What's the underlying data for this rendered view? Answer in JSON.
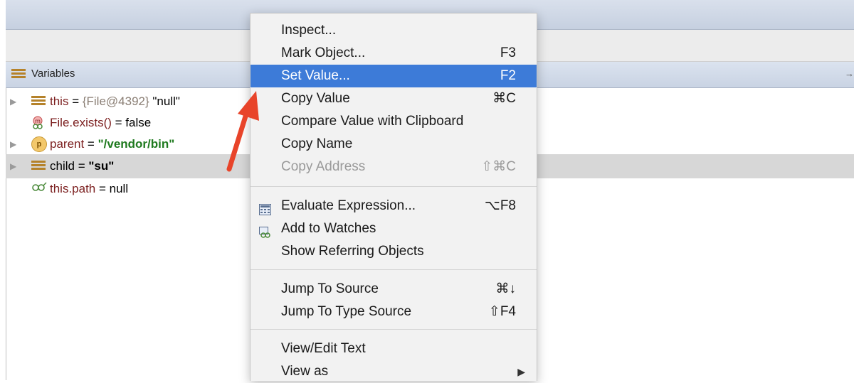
{
  "panel": {
    "title": "Variables",
    "collapse_glyph": "→"
  },
  "tree": {
    "rows": [
      {
        "name": "this",
        "eq": " = ",
        "type": "{File@4392}",
        "value": " \"null\"",
        "icon": "field-icon"
      },
      {
        "name": "File.exists()",
        "eq": " = ",
        "value": "false",
        "icon": "method-watch-icon"
      },
      {
        "name": "parent",
        "eq": " = ",
        "value": "\"/vendor/bin\"",
        "icon": "parameter-icon"
      },
      {
        "name": "child",
        "eq": " = ",
        "value": "\"su\"",
        "icon": "field-icon"
      },
      {
        "name": "this.path",
        "eq": " = ",
        "value": "null",
        "icon": "watch-icon"
      }
    ]
  },
  "menu": {
    "items": [
      {
        "label": "Inspect...",
        "shortcut": ""
      },
      {
        "label": "Mark Object...",
        "shortcut": "F3"
      },
      {
        "label": "Set Value...",
        "shortcut": "F2"
      },
      {
        "label": "Copy Value",
        "shortcut": "⌘C"
      },
      {
        "label": "Compare Value with Clipboard",
        "shortcut": ""
      },
      {
        "label": "Copy Name",
        "shortcut": ""
      },
      {
        "label": "Copy Address",
        "shortcut": "⇧⌘C"
      },
      {
        "label": "Evaluate Expression...",
        "shortcut": "⌥F8"
      },
      {
        "label": "Add to Watches",
        "shortcut": ""
      },
      {
        "label": "Show Referring Objects",
        "shortcut": ""
      },
      {
        "label": "Jump To Source",
        "shortcut": "⌘↓"
      },
      {
        "label": "Jump To Type Source",
        "shortcut": "⇧F4"
      },
      {
        "label": "View/Edit Text",
        "shortcut": ""
      },
      {
        "label": "View as",
        "shortcut": ""
      }
    ],
    "submenu_glyph": "▶"
  },
  "colors": {
    "highlight": "#3d7bd8",
    "annotation_arrow": "#e8442a"
  }
}
